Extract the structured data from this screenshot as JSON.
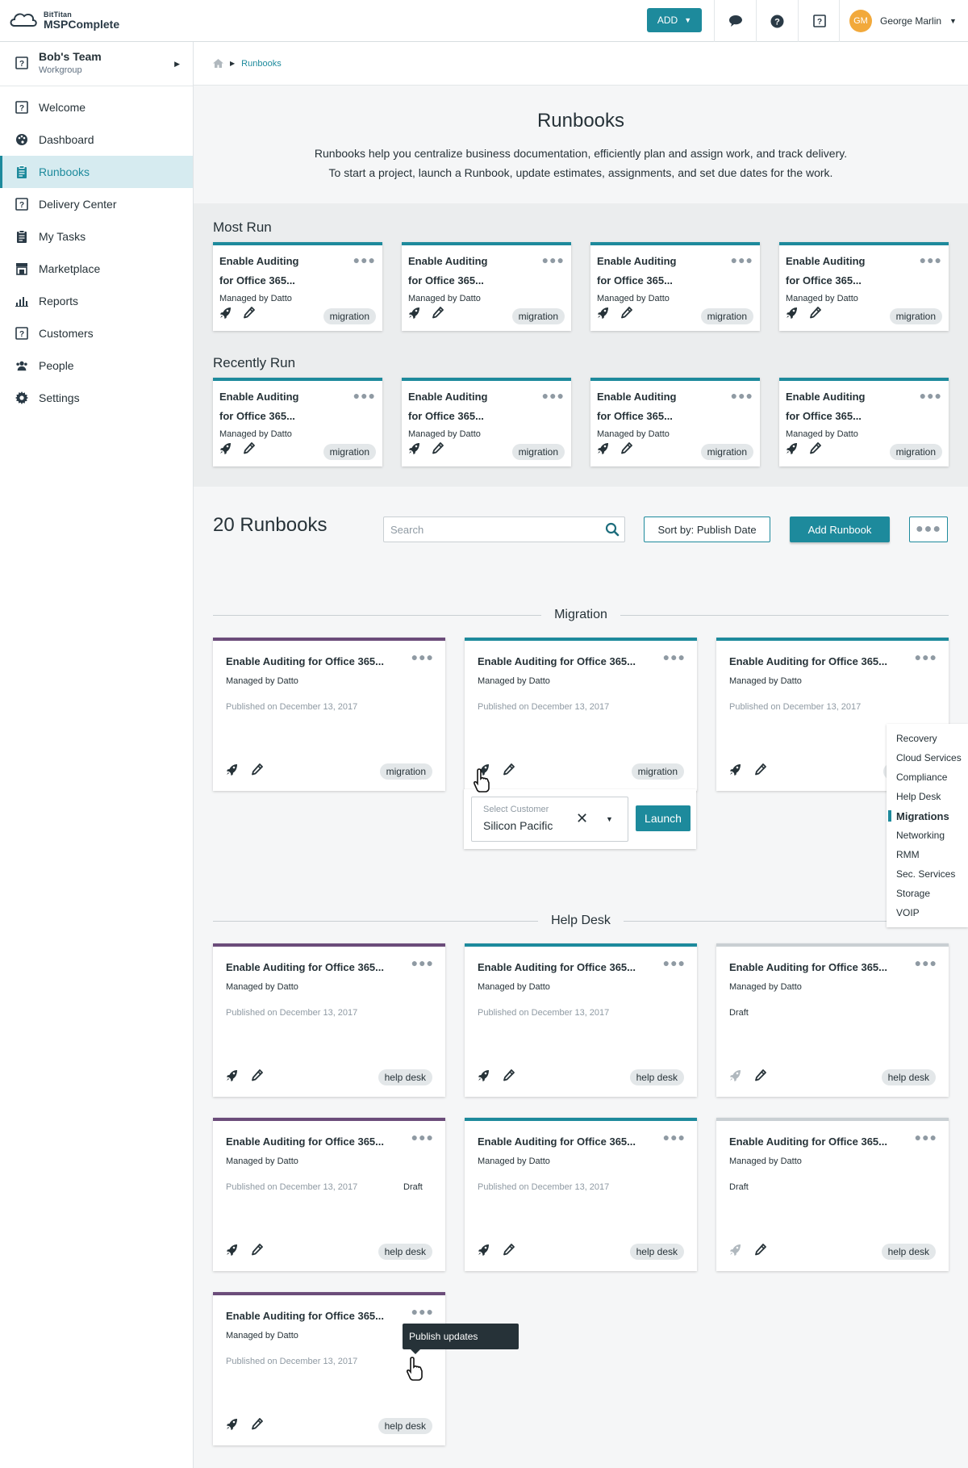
{
  "header": {
    "logo_line1": "BitTitan",
    "logo_line2": "MSPComplete",
    "add_label": "ADD",
    "user_initials": "GM",
    "user_name": "George Marlin"
  },
  "sidebar": {
    "team_name": "Bob's Team",
    "team_sub": "Workgroup",
    "items": [
      {
        "label": "Welcome",
        "icon": "question-icon"
      },
      {
        "label": "Dashboard",
        "icon": "palette-icon"
      },
      {
        "label": "Runbooks",
        "icon": "clipboard-icon",
        "active": true
      },
      {
        "label": "Delivery Center",
        "icon": "question-icon"
      },
      {
        "label": "My Tasks",
        "icon": "clipboard-icon"
      },
      {
        "label": "Marketplace",
        "icon": "store-icon"
      },
      {
        "label": "Reports",
        "icon": "bar-chart-icon"
      },
      {
        "label": "Customers",
        "icon": "question-icon"
      },
      {
        "label": "People",
        "icon": "people-icon"
      },
      {
        "label": "Settings",
        "icon": "gear-icon"
      }
    ]
  },
  "breadcrumb": {
    "current": "Runbooks"
  },
  "hero": {
    "title": "Runbooks",
    "desc1": "Runbooks help you centralize business documentation, efficiently plan and assign work, and track delivery.",
    "desc2": "To start a project, launch a Runbook, update estimates, assignments, and set due dates for the work."
  },
  "most_run": {
    "title": "Most Run",
    "cards": [
      {
        "title1": "Enable Auditing",
        "title2": "for Office 365...",
        "managed": "Managed by Datto",
        "tag": "migration"
      },
      {
        "title1": "Enable Auditing",
        "title2": "for Office 365...",
        "managed": "Managed by Datto",
        "tag": "migration"
      },
      {
        "title1": "Enable Auditing",
        "title2": "for Office 365...",
        "managed": "Managed by Datto",
        "tag": "migration"
      },
      {
        "title1": "Enable Auditing",
        "title2": "for Office 365...",
        "managed": "Managed by Datto",
        "tag": "migration"
      }
    ]
  },
  "recently_run": {
    "title": "Recently Run",
    "cards": [
      {
        "title1": "Enable Auditing",
        "title2": "for Office 365...",
        "managed": "Managed by Datto",
        "tag": "migration"
      },
      {
        "title1": "Enable Auditing",
        "title2": "for Office 365...",
        "managed": "Managed by Datto",
        "tag": "migration"
      },
      {
        "title1": "Enable Auditing",
        "title2": "for Office 365...",
        "managed": "Managed by Datto",
        "tag": "migration"
      },
      {
        "title1": "Enable Auditing",
        "title2": "for Office 365...",
        "managed": "Managed by Datto",
        "tag": "migration"
      }
    ]
  },
  "list": {
    "count": "20",
    "count_label": "Runbooks",
    "search_placeholder": "Search",
    "sort_label": "Sort by: Publish Date",
    "add_label": "Add Runbook"
  },
  "groups": [
    {
      "title": "Migration",
      "cards": [
        {
          "title": "Enable Auditing for Office 365...",
          "managed": "Managed by Datto",
          "published": "Published on December 13, 2017",
          "tag": "migration",
          "color": "#6b4c7a"
        },
        {
          "title": "Enable Auditing for Office 365...",
          "managed": "Managed by Datto",
          "published": "Published on December 13, 2017",
          "tag": "migration",
          "color": "#1d8a9c"
        },
        {
          "title": "Enable Auditing for Office 365...",
          "managed": "Managed by Datto",
          "published": "Published on December 13, 2017",
          "tag": "migration",
          "color": "#1d8a9c"
        }
      ]
    },
    {
      "title": "Help Desk",
      "cards": [
        {
          "title": "Enable Auditing for Office 365...",
          "managed": "Managed by Datto",
          "published": "Published on December 13, 2017",
          "tag": "help desk",
          "color": "#6b4c7a"
        },
        {
          "title": "Enable Auditing for Office 365...",
          "managed": "Managed by Datto",
          "published": "Published on December 13, 2017",
          "tag": "help desk",
          "color": "#1d8a9c"
        },
        {
          "title": "Enable Auditing for Office 365...",
          "managed": "Managed by Datto",
          "draft": "Draft",
          "tag": "help desk",
          "color": "#c9cfd3"
        },
        {
          "title": "Enable Auditing for Office 365...",
          "managed": "Managed by Datto",
          "published": "Published on December 13, 2017",
          "draft": "Draft",
          "tag": "help desk",
          "color": "#6b4c7a"
        },
        {
          "title": "Enable Auditing for Office 365...",
          "managed": "Managed by Datto",
          "published": "Published on December 13, 2017",
          "tag": "help desk",
          "color": "#1d8a9c"
        },
        {
          "title": "Enable Auditing for Office 365...",
          "managed": "Managed by Datto",
          "draft": "Draft",
          "tag": "help desk",
          "color": "#c9cfd3"
        },
        {
          "title": "Enable Auditing for Office 365...",
          "managed": "Managed by Datto",
          "published": "Published on December 13, 2017",
          "tag": "help desk",
          "color": "#6b4c7a"
        }
      ]
    }
  ],
  "launch": {
    "select_label": "Select Customer",
    "select_value": "Silicon Pacific",
    "launch_label": "Launch"
  },
  "filter": {
    "items": [
      "Recovery",
      "Cloud Services",
      "Compliance",
      "Help Desk",
      "Migrations",
      "Networking",
      "RMM",
      "Sec. Services",
      "Storage",
      "VOIP"
    ],
    "active": "Migrations"
  },
  "tooltip": "Publish updates"
}
